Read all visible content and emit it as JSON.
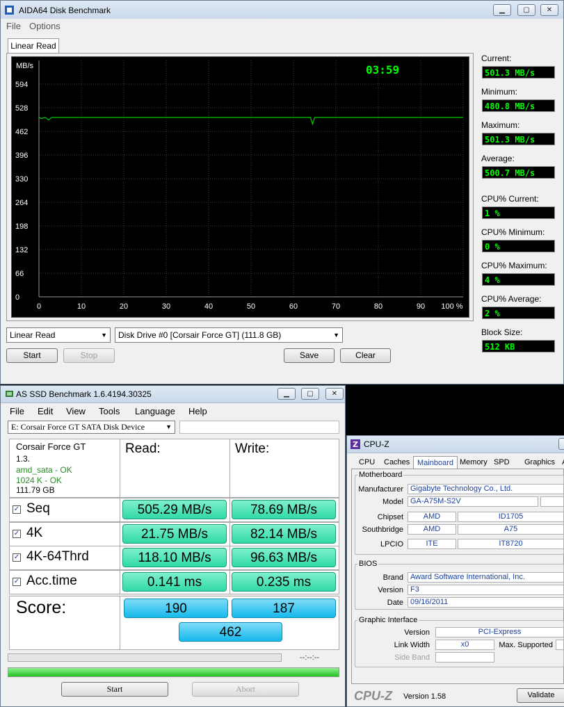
{
  "aida": {
    "title": "AIDA64 Disk Benchmark",
    "menu": [
      "File",
      "Options"
    ],
    "tab": "Linear Read",
    "timer": "03:59",
    "y_unit": "MB/s",
    "stats": [
      {
        "label": "Current:",
        "value": "501.3 MB/s"
      },
      {
        "label": "Minimum:",
        "value": "480.8 MB/s"
      },
      {
        "label": "Maximum:",
        "value": "501.3 MB/s"
      },
      {
        "label": "Average:",
        "value": "500.7 MB/s"
      },
      {
        "label": "CPU% Current:",
        "value": "1 %"
      },
      {
        "label": "CPU% Minimum:",
        "value": "0 %"
      },
      {
        "label": "CPU% Maximum:",
        "value": "4 %"
      },
      {
        "label": "CPU% Average:",
        "value": "2 %"
      },
      {
        "label": "Block Size:",
        "value": "512 KB"
      }
    ],
    "test_select": "Linear Read",
    "drive_select": "Disk Drive #0  [Corsair Force GT]  (111.8 GB)",
    "buttons": {
      "start": "Start",
      "stop": "Stop",
      "save": "Save",
      "clear": "Clear"
    }
  },
  "chart_data": {
    "type": "line",
    "ylabel": "MB/s",
    "xlabel": "",
    "ylim": [
      0,
      660
    ],
    "xlim": [
      0,
      100
    ],
    "yticks": [
      "594",
      "528",
      "462",
      "396",
      "330",
      "264",
      "198",
      "132",
      "66",
      "0"
    ],
    "ytick_values": [
      594,
      528,
      462,
      396,
      330,
      264,
      198,
      132,
      66,
      0
    ],
    "xticks": [
      "0",
      "10",
      "20",
      "30",
      "40",
      "50",
      "60",
      "70",
      "80",
      "90",
      "100 %"
    ],
    "xtick_values": [
      0,
      10,
      20,
      30,
      40,
      50,
      60,
      70,
      80,
      90,
      100
    ],
    "grid": true,
    "series": [
      {
        "color": "#00c800",
        "x": [
          0,
          0.5,
          1.5,
          2.3,
          3.0,
          10,
          30,
          50,
          64.0,
          64.5,
          65.0,
          80,
          100
        ],
        "y": [
          501,
          498,
          501,
          494,
          501,
          501,
          501,
          501,
          501,
          482,
          501,
          501,
          501
        ]
      }
    ]
  },
  "asssd": {
    "title": "AS SSD Benchmark 1.6.4194.30325",
    "menu": [
      "File",
      "Edit",
      "View",
      "Tools",
      "Language",
      "Help"
    ],
    "drive": "E: Corsair Force GT SATA Disk Device",
    "info": [
      "Corsair Force GT",
      "1.3.",
      "amd_sata - OK",
      "1024 K - OK",
      "111.79 GB"
    ],
    "read_header": "Read:",
    "write_header": "Write:",
    "rows": [
      {
        "label": "Seq",
        "read": "505.29 MB/s",
        "write": "78.69 MB/s"
      },
      {
        "label": "4K",
        "read": "21.75 MB/s",
        "write": "82.14 MB/s"
      },
      {
        "label": "4K-64Thrd",
        "read": "118.10 MB/s",
        "write": "96.63 MB/s"
      },
      {
        "label": "Acc.time",
        "read": "0.141 ms",
        "write": "0.235 ms"
      }
    ],
    "score_label": "Score:",
    "score_read": "190",
    "score_write": "187",
    "score_total": "462",
    "timer": "--:--:--",
    "start": "Start",
    "abort": "Abort",
    "progress_top": 0,
    "progress_bottom": 1.0,
    "accent": "#2fd9a7"
  },
  "cpuz": {
    "title": "CPU-Z",
    "tabs": [
      "CPU",
      "Caches",
      "Mainboard",
      "Memory",
      "SPD",
      "Graphics",
      "A"
    ],
    "motherboard": {
      "group": "Motherboard",
      "manufacturer_label": "Manufacturer",
      "manufacturer": "Gigabyte Technology Co., Ltd.",
      "model_label": "Model",
      "model": "GA-A75M-S2V",
      "chipset_label": "Chipset",
      "chipset_vendor": "AMD",
      "chipset_id": "ID1705",
      "southbridge_label": "Southbridge",
      "southbridge_vendor": "AMD",
      "southbridge_id": "A75",
      "lpcio_label": "LPCIO",
      "lpcio_vendor": "ITE",
      "lpcio_id": "IT8720"
    },
    "bios": {
      "group": "BIOS",
      "brand_label": "Brand",
      "brand": "Award Software International, Inc.",
      "version_label": "Version",
      "version": "F3",
      "date_label": "Date",
      "date": "09/16/2011"
    },
    "graphic": {
      "group": "Graphic Interface",
      "version_label": "Version",
      "version": "PCI-Express",
      "link_label": "Link Width",
      "link": "x0",
      "max_label": "Max. Supported",
      "sideband_label": "Side Band"
    },
    "logo": "CPU-Z",
    "app_version": "Version 1.58",
    "validate": "Validate"
  }
}
